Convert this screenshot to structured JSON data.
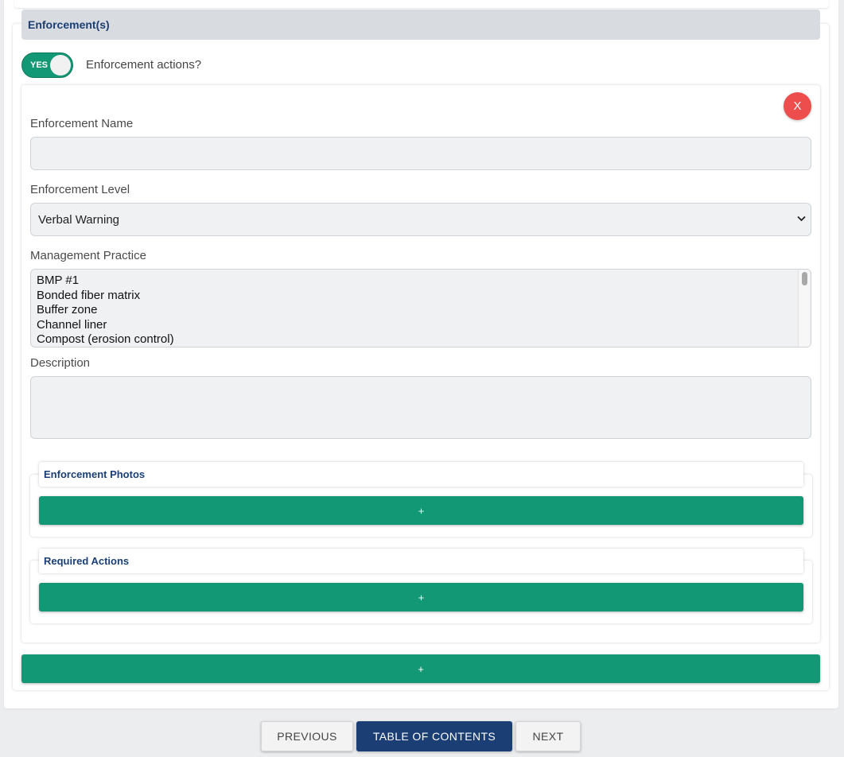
{
  "section": {
    "title": "Enforcement(s)",
    "toggle": {
      "state_label": "YES",
      "on": true
    },
    "toggle_label": "Enforcement actions?"
  },
  "entry": {
    "close_label": "X",
    "name_label": "Enforcement Name",
    "name_value": "",
    "level_label": "Enforcement Level",
    "level_value": "Verbal Warning",
    "practice_label": "Management Practice",
    "practice_options": [
      "BMP #1",
      "Bonded fiber matrix",
      "Buffer zone",
      "Channel liner",
      "Compost (erosion control)"
    ],
    "description_label": "Description",
    "description_value": "",
    "photos": {
      "title": "Enforcement Photos",
      "add_label": "+"
    },
    "actions": {
      "title": "Required Actions",
      "add_label": "+"
    }
  },
  "add_enforcement_label": "+",
  "nav": {
    "previous": "PREVIOUS",
    "toc": "TABLE OF CONTENTS",
    "next": "NEXT"
  },
  "colors": {
    "accent_green": "#129874",
    "header_navy": "#1b3f74",
    "danger_red": "#ee4d4d",
    "header_bg": "#d8dbdf"
  }
}
